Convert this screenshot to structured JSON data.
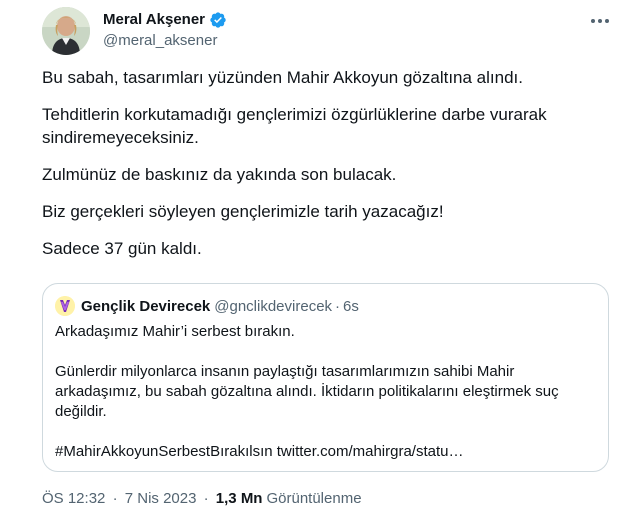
{
  "author": {
    "name": "Meral Akşener",
    "handle": "@meral_aksener",
    "verified_color": "#1d9bf0",
    "avatar_icon": "profile-photo"
  },
  "more_icon": "three-dots-icon",
  "tweet": {
    "paragraphs": [
      "Bu sabah, tasarımları yüzünden Mahir Akkoyun gözaltına alındı.",
      "Tehditlerin korkutamadığı gençlerimizi özgürlüklerine darbe vurarak sindiremeyeceksiniz.",
      "Zulmünüz de baskınız da yakında son bulacak.",
      "Biz gerçekleri söyleyen gençlerimizle tarih yazacağız!",
      "Sadece 37 gün kaldı."
    ]
  },
  "quote": {
    "name": "Gençlik Devirecek",
    "handle": "@gnclikdevirecek",
    "separator": "·",
    "time": "6s",
    "avatar_color": "#fff2a8",
    "paragraphs": [
      "Arkadaşımız Mahir’i serbest bırakın.",
      "Günlerdir milyonlarca insanın paylaştığı tasarımlarımızın sahibi Mahir arkadaşımız, bu sabah gözaltına alındı. İktidarın politikalarını eleştirmek suç değildir.",
      "#MahirAkkoyunSerbestBırakılsın twitter.com/mahirgra/statu…"
    ]
  },
  "meta": {
    "time": "ÖS 12:32",
    "separator": "·",
    "date": "7 Nis 2023",
    "views_count": "1,3 Mn",
    "views_label": "Görüntülenme"
  },
  "colors": {
    "text": "#0f1419",
    "secondary": "#536471",
    "border": "#cfd9de"
  }
}
